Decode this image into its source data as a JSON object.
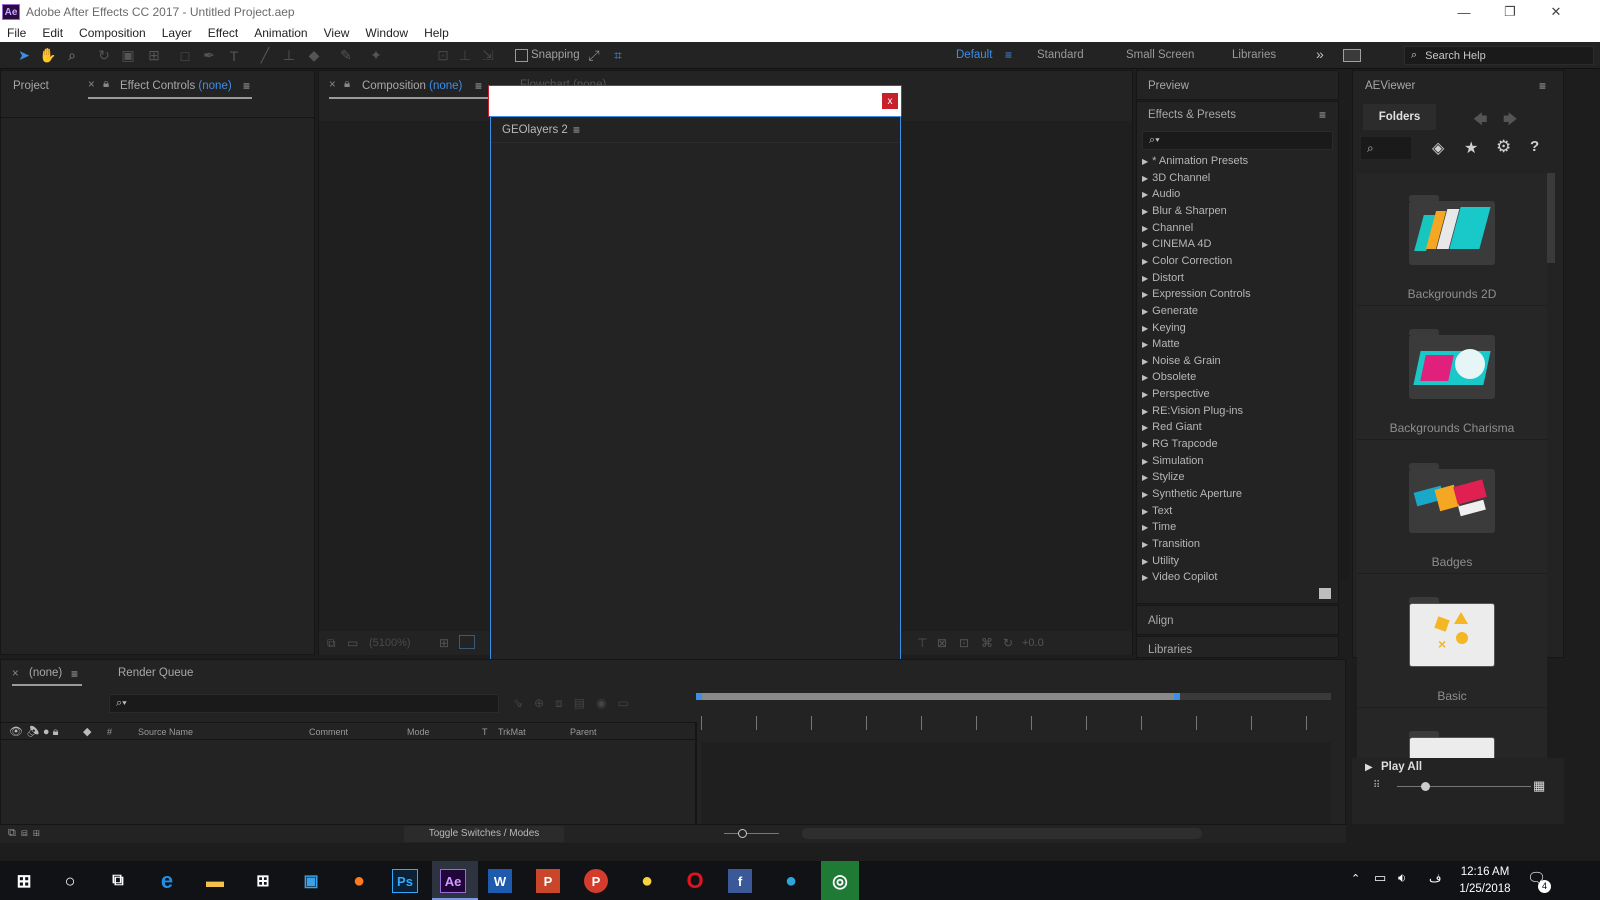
{
  "window": {
    "title": "Adobe After Effects CC 2017 - Untitled Project.aep",
    "logo_text": "Ae",
    "controls": [
      "—",
      "❐",
      "✕"
    ]
  },
  "menu": [
    "File",
    "Edit",
    "Composition",
    "Layer",
    "Effect",
    "Animation",
    "View",
    "Window",
    "Help"
  ],
  "toolbar": {
    "snapping_label": "Snapping",
    "workspaces": [
      "Default",
      "Standard",
      "Small Screen",
      "Libraries"
    ],
    "active_workspace": "Default",
    "overflow": "»",
    "search_placeholder": "Search Help"
  },
  "project_panel": {
    "tab_project": "Project",
    "tab_effect_controls": "Effect Controls",
    "effect_controls_target": "(none)"
  },
  "composition_panel": {
    "tab_label": "Composition",
    "tab_target": "(none)",
    "flowchart_label": "Flowchart",
    "flowchart_target": "(none)",
    "zoom": "(5100%)",
    "exposure": "+0.0"
  },
  "dialog": {
    "panel_title": "GEOlayers 2",
    "close_label": "x"
  },
  "right_panels": {
    "preview": "Preview",
    "effects_presets": "Effects & Presets",
    "align": "Align",
    "libraries": "Libraries"
  },
  "effects_list": [
    "* Animation Presets",
    "3D Channel",
    "Audio",
    "Blur & Sharpen",
    "Channel",
    "CINEMA 4D",
    "Color Correction",
    "Distort",
    "Expression Controls",
    "Generate",
    "Keying",
    "Matte",
    "Noise & Grain",
    "Obsolete",
    "Perspective",
    "RE:Vision Plug-ins",
    "Red Giant",
    "RG Trapcode",
    "Simulation",
    "Stylize",
    "Synthetic Aperture",
    "Text",
    "Time",
    "Transition",
    "Utility",
    "Video Copilot"
  ],
  "aeviewer": {
    "title": "AEViewer",
    "folders_tab": "Folders",
    "categories": [
      "Backgrounds 2D",
      "Backgrounds Charisma",
      "Badges",
      "Basic"
    ],
    "play_all": "Play All"
  },
  "timeline": {
    "tab_none": "(none)",
    "tab_render_queue": "Render Queue",
    "columns": [
      "#",
      "Source Name",
      "Comment",
      "Mode",
      "T",
      "TrkMat",
      "Parent"
    ],
    "toggle_label": "Toggle Switches / Modes"
  },
  "taskbar": {
    "time": "12:16 AM",
    "date": "1/25/2018",
    "notification_count": "4",
    "lang": "ف",
    "apps": [
      "Ps",
      "Ae",
      "W",
      "P",
      "P",
      "O",
      "f"
    ]
  },
  "colors": {
    "accent": "#3d8ee8",
    "panel": "#232323",
    "dialog_border": "#c8202b",
    "close_red": "#c8202b"
  }
}
